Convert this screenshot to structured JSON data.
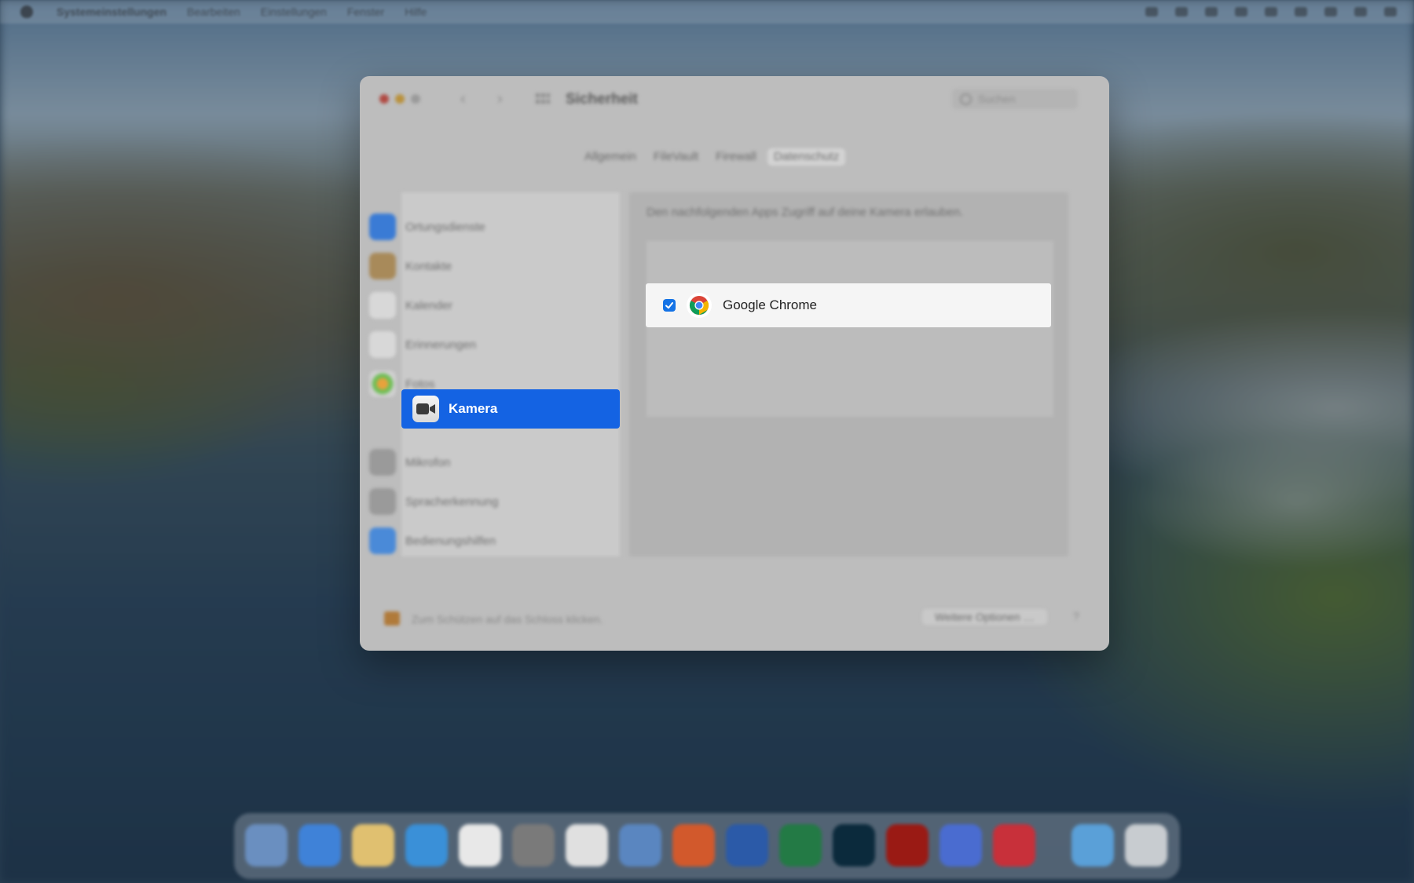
{
  "menubar": {
    "apple_icon": "apple-logo",
    "items": [
      "Systemeinstellungen",
      "Bearbeiten",
      "Einstellungen",
      "Fenster",
      "Hilfe"
    ]
  },
  "window": {
    "title": "Sicherheit",
    "search_placeholder": "Suchen",
    "tabs": [
      {
        "label": "Allgemein",
        "active": false
      },
      {
        "label": "FileVault",
        "active": false
      },
      {
        "label": "Firewall",
        "active": false
      },
      {
        "label": "Datenschutz",
        "active": true
      }
    ],
    "privacy_categories": [
      {
        "label": "Ortungsdienste",
        "icon": "location-icon",
        "color": "#3a7bd5"
      },
      {
        "label": "Kontakte",
        "icon": "contacts-icon",
        "color": "#a88a5a"
      },
      {
        "label": "Kalender",
        "icon": "calendar-icon",
        "color": "#d8d8d8"
      },
      {
        "label": "Erinnerungen",
        "icon": "reminders-icon",
        "color": "#d8d8d8"
      },
      {
        "label": "Fotos",
        "icon": "photos-icon",
        "color": "#d8d8d8"
      },
      {
        "label": "Kamera",
        "icon": "camera-icon",
        "selected": true
      },
      {
        "label": "Mikrofon",
        "icon": "microphone-icon",
        "color": "#9a9a9a"
      },
      {
        "label": "Spracherkennung",
        "icon": "speech-icon",
        "color": "#9a9a9a"
      },
      {
        "label": "Bedienungshilfen",
        "icon": "accessibility-icon",
        "color": "#4a8ad8"
      }
    ],
    "camera_description": "Den nachfolgenden Apps Zugriff auf deine Kamera erlauben.",
    "apps": [
      {
        "name": "Google Chrome",
        "checked": true,
        "icon": "chrome-icon"
      }
    ],
    "footer": {
      "lock_text": "Zum Schützen auf das Schloss klicken.",
      "more_options": "Weitere Optionen …",
      "help": "?"
    }
  },
  "colors": {
    "selection_blue": "#1463e3",
    "checkbox_blue": "#1473e6"
  }
}
